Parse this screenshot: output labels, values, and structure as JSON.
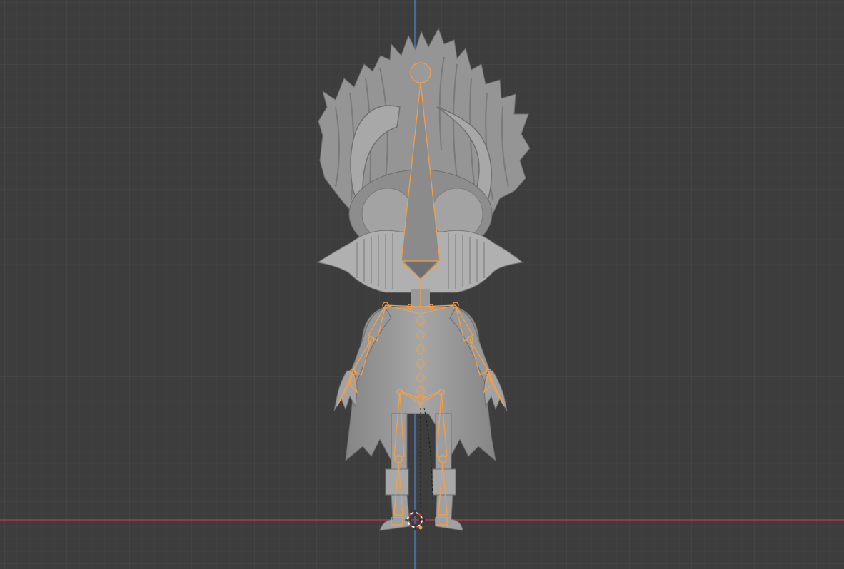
{
  "viewport": {
    "background_color": "#3d3d3d",
    "grid_minor_color": "#434343",
    "grid_major_color": "#4a4a4a",
    "x_axis_color": "#b23a46",
    "z_axis_color": "#4a78b8",
    "selection_color": "#f0a04a",
    "mesh_color": "#9b9b9b",
    "mesh_shadow_color": "#7e7e7e",
    "mesh_highlight_color": "#b4b4b4"
  },
  "scene_objects": {
    "character_mesh": "chibi-character-mesh",
    "armature": "armature-selected",
    "cursor_icon": "3d-cursor-icon"
  }
}
